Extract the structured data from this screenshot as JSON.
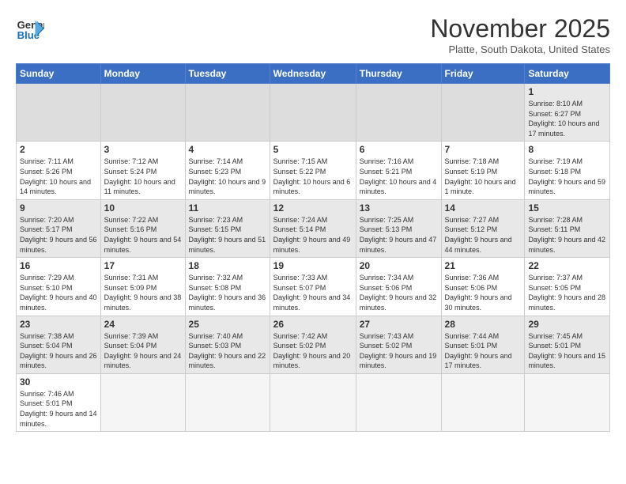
{
  "header": {
    "logo_text_general": "General",
    "logo_text_blue": "Blue",
    "month": "November 2025",
    "location": "Platte, South Dakota, United States"
  },
  "weekdays": [
    "Sunday",
    "Monday",
    "Tuesday",
    "Wednesday",
    "Thursday",
    "Friday",
    "Saturday"
  ],
  "weeks": [
    [
      {
        "day": "",
        "info": ""
      },
      {
        "day": "",
        "info": ""
      },
      {
        "day": "",
        "info": ""
      },
      {
        "day": "",
        "info": ""
      },
      {
        "day": "",
        "info": ""
      },
      {
        "day": "",
        "info": ""
      },
      {
        "day": "1",
        "info": "Sunrise: 8:10 AM\nSunset: 6:27 PM\nDaylight: 10 hours\nand 17 minutes."
      }
    ],
    [
      {
        "day": "2",
        "info": "Sunrise: 7:11 AM\nSunset: 5:26 PM\nDaylight: 10 hours\nand 14 minutes."
      },
      {
        "day": "3",
        "info": "Sunrise: 7:12 AM\nSunset: 5:24 PM\nDaylight: 10 hours\nand 11 minutes."
      },
      {
        "day": "4",
        "info": "Sunrise: 7:14 AM\nSunset: 5:23 PM\nDaylight: 10 hours\nand 9 minutes."
      },
      {
        "day": "5",
        "info": "Sunrise: 7:15 AM\nSunset: 5:22 PM\nDaylight: 10 hours\nand 6 minutes."
      },
      {
        "day": "6",
        "info": "Sunrise: 7:16 AM\nSunset: 5:21 PM\nDaylight: 10 hours\nand 4 minutes."
      },
      {
        "day": "7",
        "info": "Sunrise: 7:18 AM\nSunset: 5:19 PM\nDaylight: 10 hours\nand 1 minute."
      },
      {
        "day": "8",
        "info": "Sunrise: 7:19 AM\nSunset: 5:18 PM\nDaylight: 9 hours\nand 59 minutes."
      }
    ],
    [
      {
        "day": "9",
        "info": "Sunrise: 7:20 AM\nSunset: 5:17 PM\nDaylight: 9 hours\nand 56 minutes."
      },
      {
        "day": "10",
        "info": "Sunrise: 7:22 AM\nSunset: 5:16 PM\nDaylight: 9 hours\nand 54 minutes."
      },
      {
        "day": "11",
        "info": "Sunrise: 7:23 AM\nSunset: 5:15 PM\nDaylight: 9 hours\nand 51 minutes."
      },
      {
        "day": "12",
        "info": "Sunrise: 7:24 AM\nSunset: 5:14 PM\nDaylight: 9 hours\nand 49 minutes."
      },
      {
        "day": "13",
        "info": "Sunrise: 7:25 AM\nSunset: 5:13 PM\nDaylight: 9 hours\nand 47 minutes."
      },
      {
        "day": "14",
        "info": "Sunrise: 7:27 AM\nSunset: 5:12 PM\nDaylight: 9 hours\nand 44 minutes."
      },
      {
        "day": "15",
        "info": "Sunrise: 7:28 AM\nSunset: 5:11 PM\nDaylight: 9 hours\nand 42 minutes."
      }
    ],
    [
      {
        "day": "16",
        "info": "Sunrise: 7:29 AM\nSunset: 5:10 PM\nDaylight: 9 hours\nand 40 minutes."
      },
      {
        "day": "17",
        "info": "Sunrise: 7:31 AM\nSunset: 5:09 PM\nDaylight: 9 hours\nand 38 minutes."
      },
      {
        "day": "18",
        "info": "Sunrise: 7:32 AM\nSunset: 5:08 PM\nDaylight: 9 hours\nand 36 minutes."
      },
      {
        "day": "19",
        "info": "Sunrise: 7:33 AM\nSunset: 5:07 PM\nDaylight: 9 hours\nand 34 minutes."
      },
      {
        "day": "20",
        "info": "Sunrise: 7:34 AM\nSunset: 5:06 PM\nDaylight: 9 hours\nand 32 minutes."
      },
      {
        "day": "21",
        "info": "Sunrise: 7:36 AM\nSunset: 5:06 PM\nDaylight: 9 hours\nand 30 minutes."
      },
      {
        "day": "22",
        "info": "Sunrise: 7:37 AM\nSunset: 5:05 PM\nDaylight: 9 hours\nand 28 minutes."
      }
    ],
    [
      {
        "day": "23",
        "info": "Sunrise: 7:38 AM\nSunset: 5:04 PM\nDaylight: 9 hours\nand 26 minutes."
      },
      {
        "day": "24",
        "info": "Sunrise: 7:39 AM\nSunset: 5:04 PM\nDaylight: 9 hours\nand 24 minutes."
      },
      {
        "day": "25",
        "info": "Sunrise: 7:40 AM\nSunset: 5:03 PM\nDaylight: 9 hours\nand 22 minutes."
      },
      {
        "day": "26",
        "info": "Sunrise: 7:42 AM\nSunset: 5:02 PM\nDaylight: 9 hours\nand 20 minutes."
      },
      {
        "day": "27",
        "info": "Sunrise: 7:43 AM\nSunset: 5:02 PM\nDaylight: 9 hours\nand 19 minutes."
      },
      {
        "day": "28",
        "info": "Sunrise: 7:44 AM\nSunset: 5:01 PM\nDaylight: 9 hours\nand 17 minutes."
      },
      {
        "day": "29",
        "info": "Sunrise: 7:45 AM\nSunset: 5:01 PM\nDaylight: 9 hours\nand 15 minutes."
      }
    ],
    [
      {
        "day": "30",
        "info": "Sunrise: 7:46 AM\nSunset: 5:01 PM\nDaylight: 9 hours\nand 14 minutes."
      },
      {
        "day": "",
        "info": ""
      },
      {
        "day": "",
        "info": ""
      },
      {
        "day": "",
        "info": ""
      },
      {
        "day": "",
        "info": ""
      },
      {
        "day": "",
        "info": ""
      },
      {
        "day": "",
        "info": ""
      }
    ]
  ]
}
